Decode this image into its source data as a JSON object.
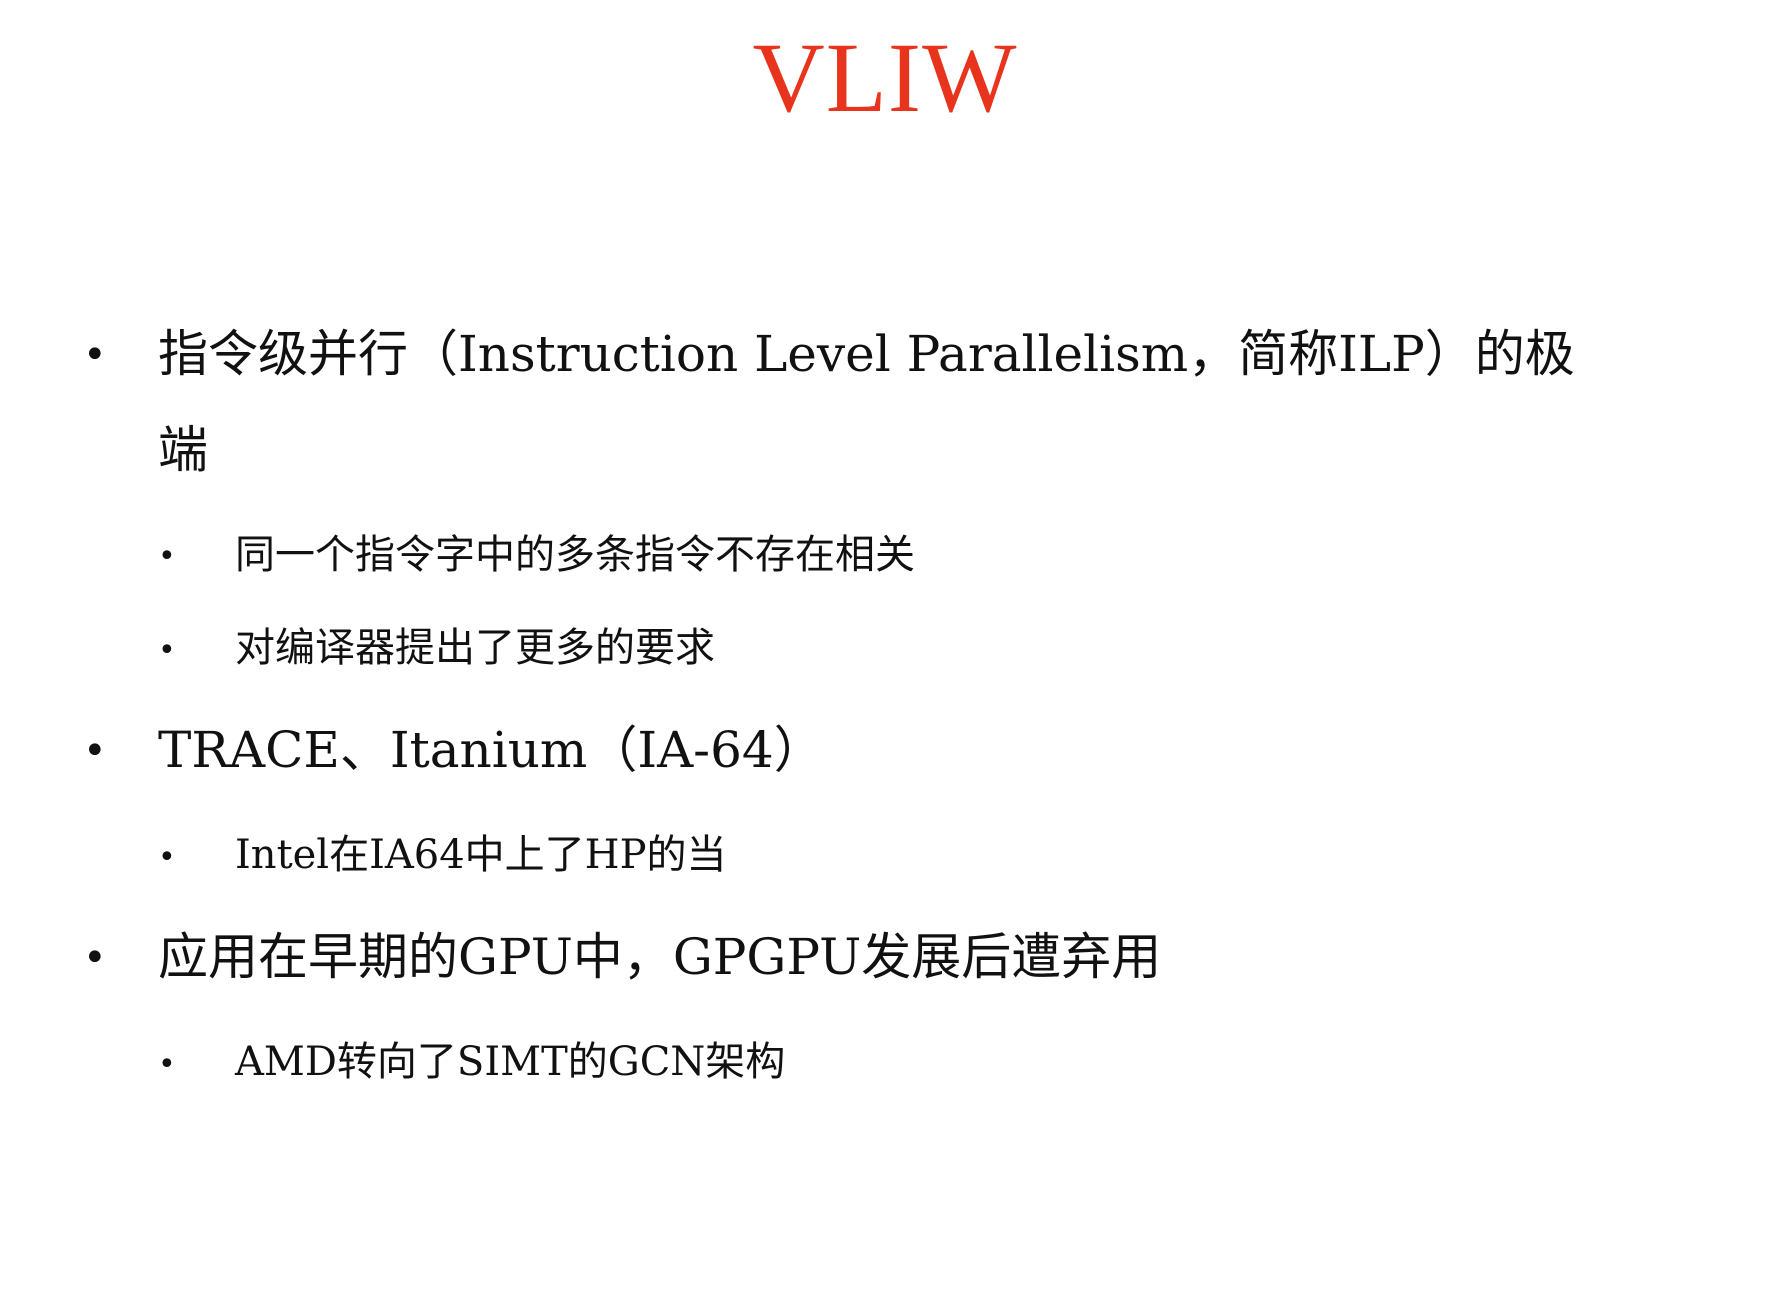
{
  "slide": {
    "title": "VLIW",
    "bullets": [
      {
        "text": "指令级并行（Instruction Level Parallelism，简称ILP）的极",
        "continuation": "端",
        "sub": [
          "同一个指令字中的多条指令不存在相关",
          "对编译器提出了更多的要求"
        ]
      },
      {
        "text": "TRACE、Itanium（IA-64）",
        "sub": [
          "Intel在IA64中上了HP的当"
        ]
      },
      {
        "text": "应用在早期的GPU中，GPGPU发展后遭弃用",
        "sub": [
          "AMD转向了SIMT的GCN架构"
        ]
      }
    ],
    "bullet_symbol": "•",
    "colors": {
      "title": "#e8341c",
      "text": "#111111",
      "background": "#ffffff"
    }
  }
}
